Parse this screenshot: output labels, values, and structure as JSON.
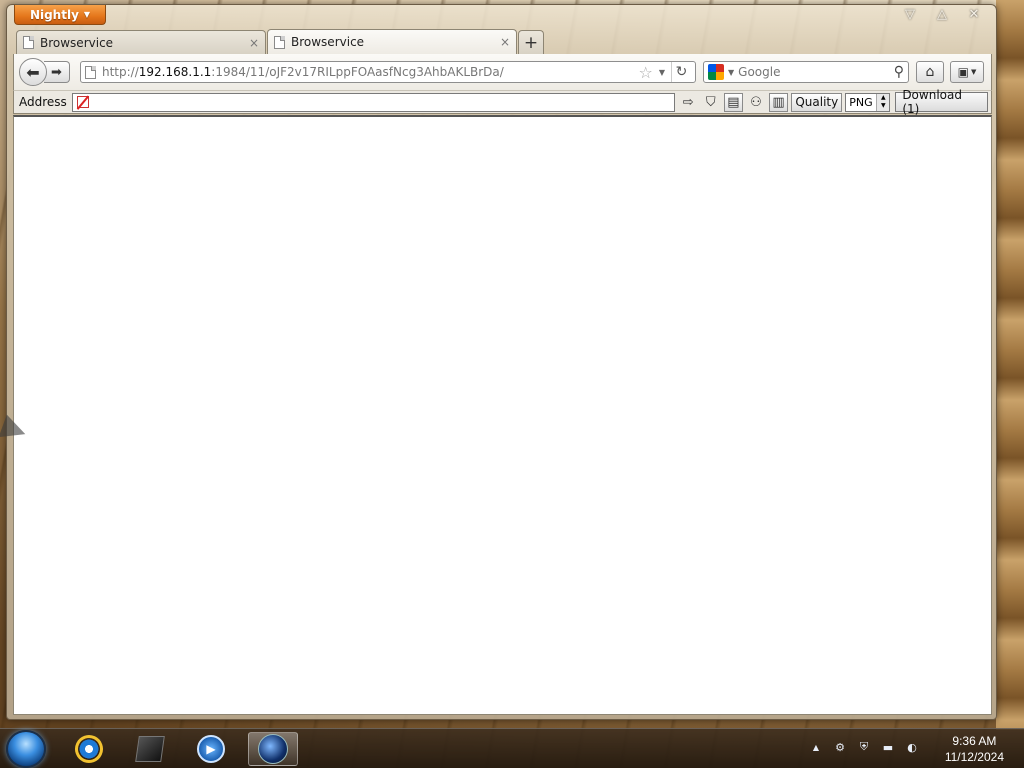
{
  "app": {
    "menu_button_label": "Nightly",
    "window_controls": {
      "minimize": "▽",
      "maximize": "△",
      "close": "✕"
    }
  },
  "tabs": [
    {
      "title": "Browservice",
      "close": "×",
      "active": false
    },
    {
      "title": "Browservice",
      "close": "×",
      "active": true
    }
  ],
  "new_tab_label": "+",
  "navbar": {
    "url_prefix": "http://",
    "url_host": "192.168.1.1",
    "url_rest": ":1984/11/oJF2v17RILppFOAasfNcg3AhbAKLBrDa/",
    "search_placeholder": "Google"
  },
  "address_toolbar": {
    "label": "Address",
    "address_value": "",
    "quality_label": "Quality",
    "quality_value": "PNG",
    "download_label": "Download (1)"
  },
  "taskbar": {
    "clock_time": "9:36 AM",
    "clock_date": "11/12/2024",
    "tray_overflow": "▲"
  }
}
